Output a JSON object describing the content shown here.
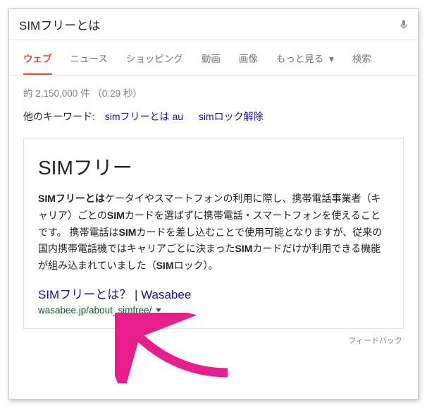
{
  "search": {
    "query": "SIMフリーとは"
  },
  "tabs": {
    "web": "ウェブ",
    "news": "ニュース",
    "shopping": "ショッピング",
    "video": "動画",
    "image": "画像",
    "more": "もっと見る",
    "search": "検索"
  },
  "stats": "約 2,150,000 件 （0.29 秒）",
  "related": {
    "label": "他のキーワード:",
    "links": [
      "simフリーとは au",
      "simロック解除"
    ]
  },
  "card": {
    "title": "SIMフリー",
    "body_html": "<b>SIMフリーとは</b>ケータイやスマートフォンの利用に際し、携帯電話事業者（キャリア）ごとの<b>SIM</b>カードを選ばずに携帯電話・スマートフォンを使えることです。 携帯電話は<b>SIM</b>カードを差し込むことで使用可能となりますが、従来の国内携帯電話機ではキャリアごとに決まった<b>SIM</b>カードだけが利用できる機能が組み込まれていました（<b>SIM</b>ロック）。",
    "source_title": "SIMフリーとは？ | Wasabee",
    "source_url_display": "wasabee.jp/about_simfree/"
  },
  "feedback_label": "フィードバック"
}
